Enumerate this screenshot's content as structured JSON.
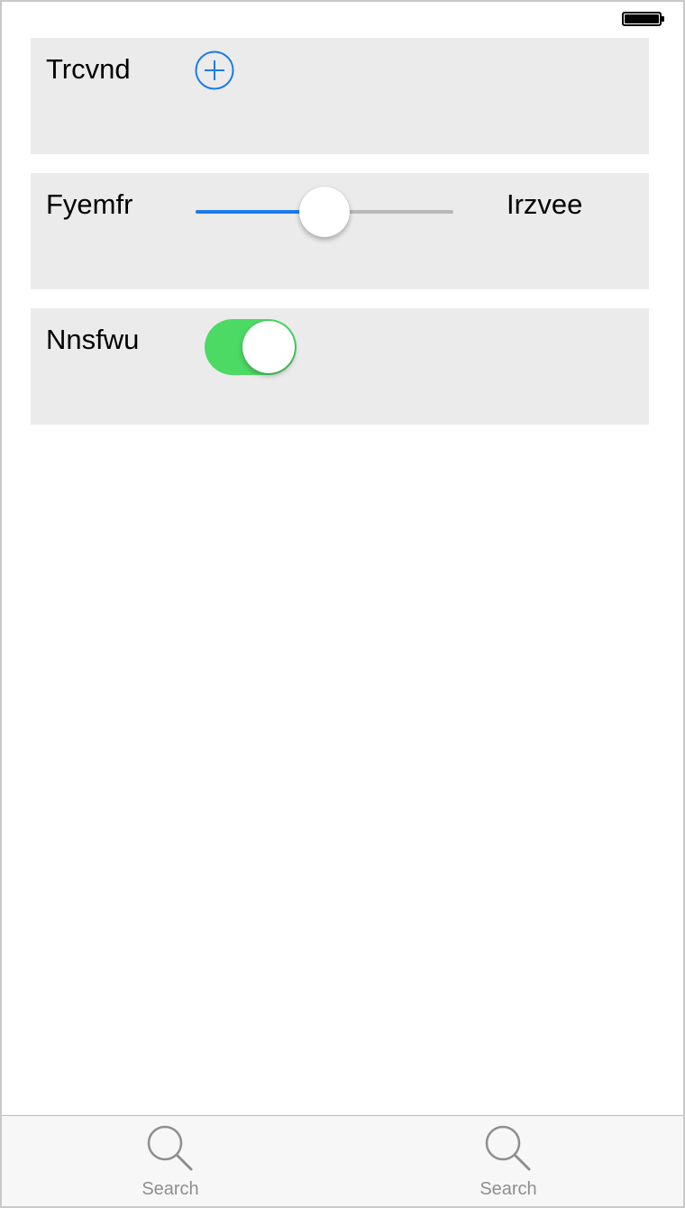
{
  "rows": [
    {
      "label": "Trcvnd",
      "control": "add-button"
    },
    {
      "label": "Fyemfr",
      "control": "slider",
      "slider_value": 0.5,
      "max_label": "Irzvee"
    },
    {
      "label": "Nnsfwu",
      "control": "toggle",
      "toggle_on": true
    }
  ],
  "tab_bar": {
    "items": [
      {
        "label": "Search",
        "icon": "search-icon"
      },
      {
        "label": "Search",
        "icon": "search-icon"
      }
    ]
  },
  "colors": {
    "accent": "#1a7ce8",
    "toggle_on": "#4cd964",
    "row_background": "#ebebeb",
    "slider_track": "#b8b8b8",
    "tab_label": "#8e8e8e"
  }
}
